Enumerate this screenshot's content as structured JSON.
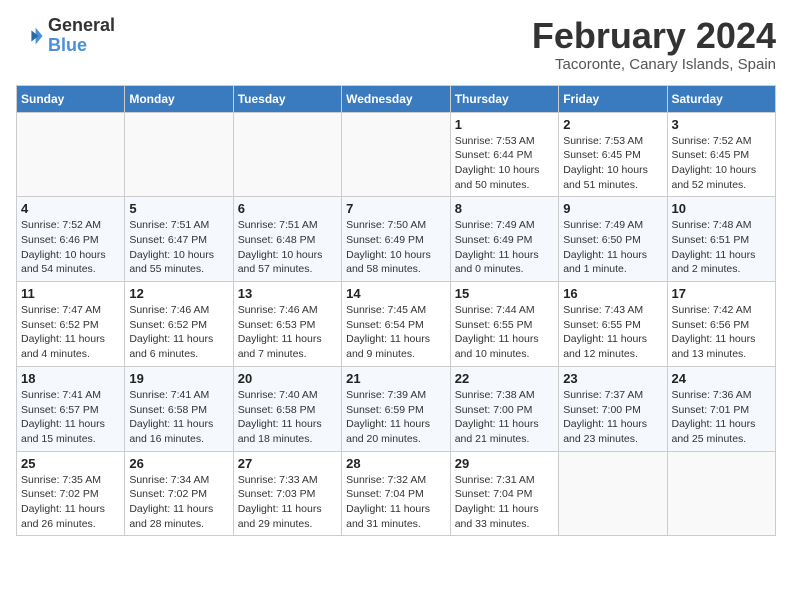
{
  "header": {
    "logo_general": "General",
    "logo_blue": "Blue",
    "month_title": "February 2024",
    "location": "Tacoronte, Canary Islands, Spain"
  },
  "weekdays": [
    "Sunday",
    "Monday",
    "Tuesday",
    "Wednesday",
    "Thursday",
    "Friday",
    "Saturday"
  ],
  "weeks": [
    [
      {
        "day": "",
        "info": ""
      },
      {
        "day": "",
        "info": ""
      },
      {
        "day": "",
        "info": ""
      },
      {
        "day": "",
        "info": ""
      },
      {
        "day": "1",
        "info": "Sunrise: 7:53 AM\nSunset: 6:44 PM\nDaylight: 10 hours\nand 50 minutes."
      },
      {
        "day": "2",
        "info": "Sunrise: 7:53 AM\nSunset: 6:45 PM\nDaylight: 10 hours\nand 51 minutes."
      },
      {
        "day": "3",
        "info": "Sunrise: 7:52 AM\nSunset: 6:45 PM\nDaylight: 10 hours\nand 52 minutes."
      }
    ],
    [
      {
        "day": "4",
        "info": "Sunrise: 7:52 AM\nSunset: 6:46 PM\nDaylight: 10 hours\nand 54 minutes."
      },
      {
        "day": "5",
        "info": "Sunrise: 7:51 AM\nSunset: 6:47 PM\nDaylight: 10 hours\nand 55 minutes."
      },
      {
        "day": "6",
        "info": "Sunrise: 7:51 AM\nSunset: 6:48 PM\nDaylight: 10 hours\nand 57 minutes."
      },
      {
        "day": "7",
        "info": "Sunrise: 7:50 AM\nSunset: 6:49 PM\nDaylight: 10 hours\nand 58 minutes."
      },
      {
        "day": "8",
        "info": "Sunrise: 7:49 AM\nSunset: 6:49 PM\nDaylight: 11 hours\nand 0 minutes."
      },
      {
        "day": "9",
        "info": "Sunrise: 7:49 AM\nSunset: 6:50 PM\nDaylight: 11 hours\nand 1 minute."
      },
      {
        "day": "10",
        "info": "Sunrise: 7:48 AM\nSunset: 6:51 PM\nDaylight: 11 hours\nand 2 minutes."
      }
    ],
    [
      {
        "day": "11",
        "info": "Sunrise: 7:47 AM\nSunset: 6:52 PM\nDaylight: 11 hours\nand 4 minutes."
      },
      {
        "day": "12",
        "info": "Sunrise: 7:46 AM\nSunset: 6:52 PM\nDaylight: 11 hours\nand 6 minutes."
      },
      {
        "day": "13",
        "info": "Sunrise: 7:46 AM\nSunset: 6:53 PM\nDaylight: 11 hours\nand 7 minutes."
      },
      {
        "day": "14",
        "info": "Sunrise: 7:45 AM\nSunset: 6:54 PM\nDaylight: 11 hours\nand 9 minutes."
      },
      {
        "day": "15",
        "info": "Sunrise: 7:44 AM\nSunset: 6:55 PM\nDaylight: 11 hours\nand 10 minutes."
      },
      {
        "day": "16",
        "info": "Sunrise: 7:43 AM\nSunset: 6:55 PM\nDaylight: 11 hours\nand 12 minutes."
      },
      {
        "day": "17",
        "info": "Sunrise: 7:42 AM\nSunset: 6:56 PM\nDaylight: 11 hours\nand 13 minutes."
      }
    ],
    [
      {
        "day": "18",
        "info": "Sunrise: 7:41 AM\nSunset: 6:57 PM\nDaylight: 11 hours\nand 15 minutes."
      },
      {
        "day": "19",
        "info": "Sunrise: 7:41 AM\nSunset: 6:58 PM\nDaylight: 11 hours\nand 16 minutes."
      },
      {
        "day": "20",
        "info": "Sunrise: 7:40 AM\nSunset: 6:58 PM\nDaylight: 11 hours\nand 18 minutes."
      },
      {
        "day": "21",
        "info": "Sunrise: 7:39 AM\nSunset: 6:59 PM\nDaylight: 11 hours\nand 20 minutes."
      },
      {
        "day": "22",
        "info": "Sunrise: 7:38 AM\nSunset: 7:00 PM\nDaylight: 11 hours\nand 21 minutes."
      },
      {
        "day": "23",
        "info": "Sunrise: 7:37 AM\nSunset: 7:00 PM\nDaylight: 11 hours\nand 23 minutes."
      },
      {
        "day": "24",
        "info": "Sunrise: 7:36 AM\nSunset: 7:01 PM\nDaylight: 11 hours\nand 25 minutes."
      }
    ],
    [
      {
        "day": "25",
        "info": "Sunrise: 7:35 AM\nSunset: 7:02 PM\nDaylight: 11 hours\nand 26 minutes."
      },
      {
        "day": "26",
        "info": "Sunrise: 7:34 AM\nSunset: 7:02 PM\nDaylight: 11 hours\nand 28 minutes."
      },
      {
        "day": "27",
        "info": "Sunrise: 7:33 AM\nSunset: 7:03 PM\nDaylight: 11 hours\nand 29 minutes."
      },
      {
        "day": "28",
        "info": "Sunrise: 7:32 AM\nSunset: 7:04 PM\nDaylight: 11 hours\nand 31 minutes."
      },
      {
        "day": "29",
        "info": "Sunrise: 7:31 AM\nSunset: 7:04 PM\nDaylight: 11 hours\nand 33 minutes."
      },
      {
        "day": "",
        "info": ""
      },
      {
        "day": "",
        "info": ""
      }
    ]
  ]
}
